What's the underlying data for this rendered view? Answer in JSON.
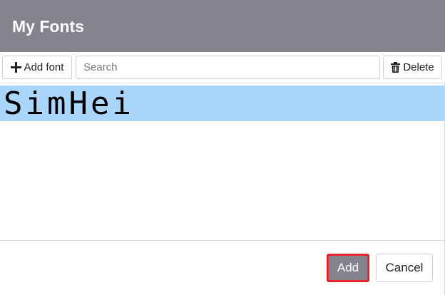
{
  "dialog": {
    "title": "My Fonts"
  },
  "toolbar": {
    "add_font_label": "Add font",
    "add_font_icon": "plus-icon",
    "search_placeholder": "Search",
    "search_value": "",
    "delete_label": "Delete",
    "delete_icon": "trash-icon"
  },
  "fonts": {
    "items": [
      {
        "name": "SimHei",
        "selected": true
      }
    ]
  },
  "footer": {
    "add_label": "Add",
    "cancel_label": "Cancel"
  },
  "colors": {
    "header_bg": "#858290",
    "selection_bg": "#a9d6fa",
    "highlight_border": "#e8232a"
  }
}
